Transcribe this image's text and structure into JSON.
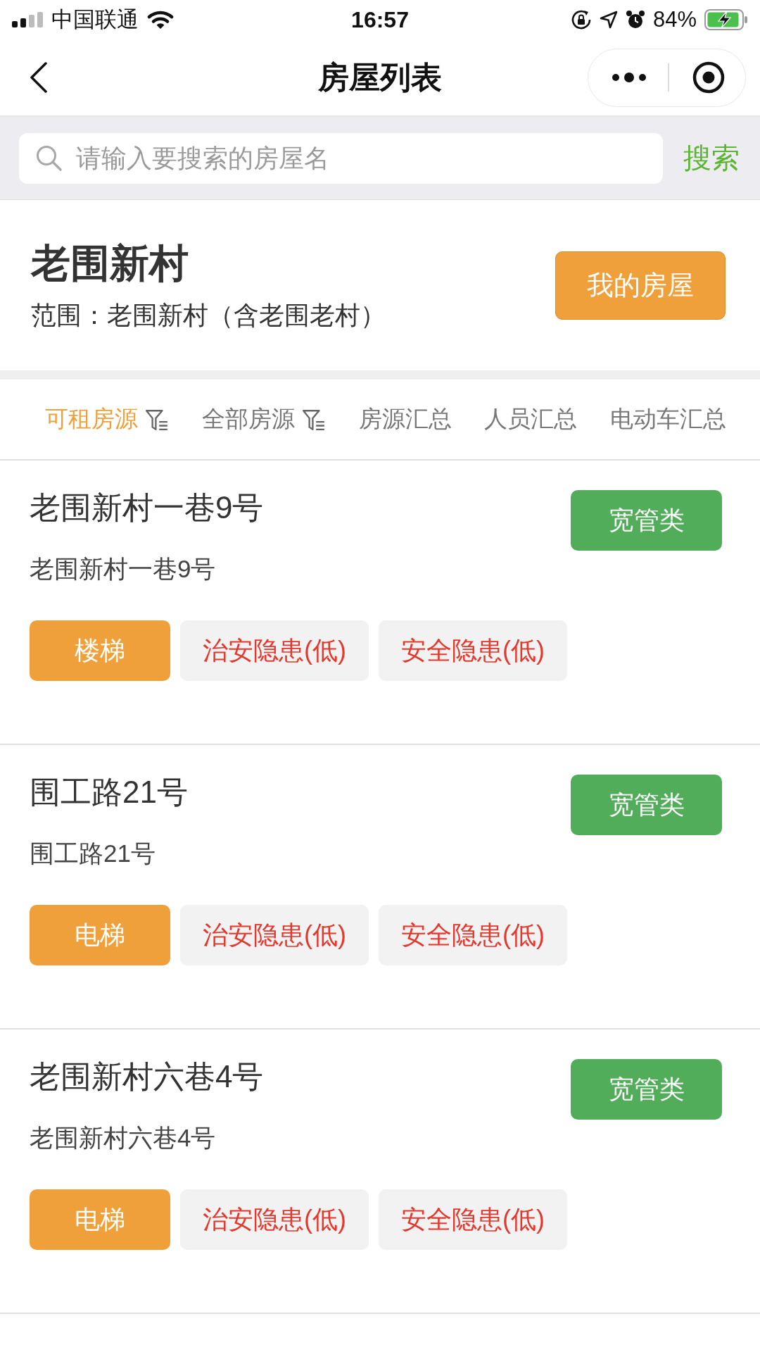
{
  "status_bar": {
    "carrier": "中国联通",
    "time": "16:57",
    "battery": "84%"
  },
  "nav": {
    "title": "房屋列表"
  },
  "search": {
    "placeholder": "请输入要搜索的房屋名",
    "button": "搜索"
  },
  "community": {
    "name": "老围新村",
    "scope": "范围：老围新村（含老围老村）",
    "button": "我的房屋"
  },
  "tabs": [
    {
      "label": "可租房源",
      "selected": true,
      "filter": true
    },
    {
      "label": "全部房源",
      "selected": false,
      "filter": true
    },
    {
      "label": "房源汇总",
      "selected": false,
      "filter": false
    },
    {
      "label": "人员汇总",
      "selected": false,
      "filter": false
    },
    {
      "label": "电动车汇总",
      "selected": false,
      "filter": false
    }
  ],
  "houses": [
    {
      "title": "老围新村一巷9号",
      "address": "老围新村一巷9号",
      "category": "宽管类",
      "tags": [
        {
          "label": "楼梯",
          "kind": "facility"
        },
        {
          "label": "治安隐患(低)",
          "kind": "hazard"
        },
        {
          "label": "安全隐患(低)",
          "kind": "hazard"
        }
      ]
    },
    {
      "title": "围工路21号",
      "address": "围工路21号",
      "category": "宽管类",
      "tags": [
        {
          "label": "电梯",
          "kind": "facility"
        },
        {
          "label": "治安隐患(低)",
          "kind": "hazard"
        },
        {
          "label": "安全隐患(低)",
          "kind": "hazard"
        }
      ]
    },
    {
      "title": "老围新村六巷4号",
      "address": "老围新村六巷4号",
      "category": "宽管类",
      "tags": [
        {
          "label": "电梯",
          "kind": "facility"
        },
        {
          "label": "治安隐患(低)",
          "kind": "hazard"
        },
        {
          "label": "安全隐患(低)",
          "kind": "hazard"
        }
      ]
    }
  ]
}
